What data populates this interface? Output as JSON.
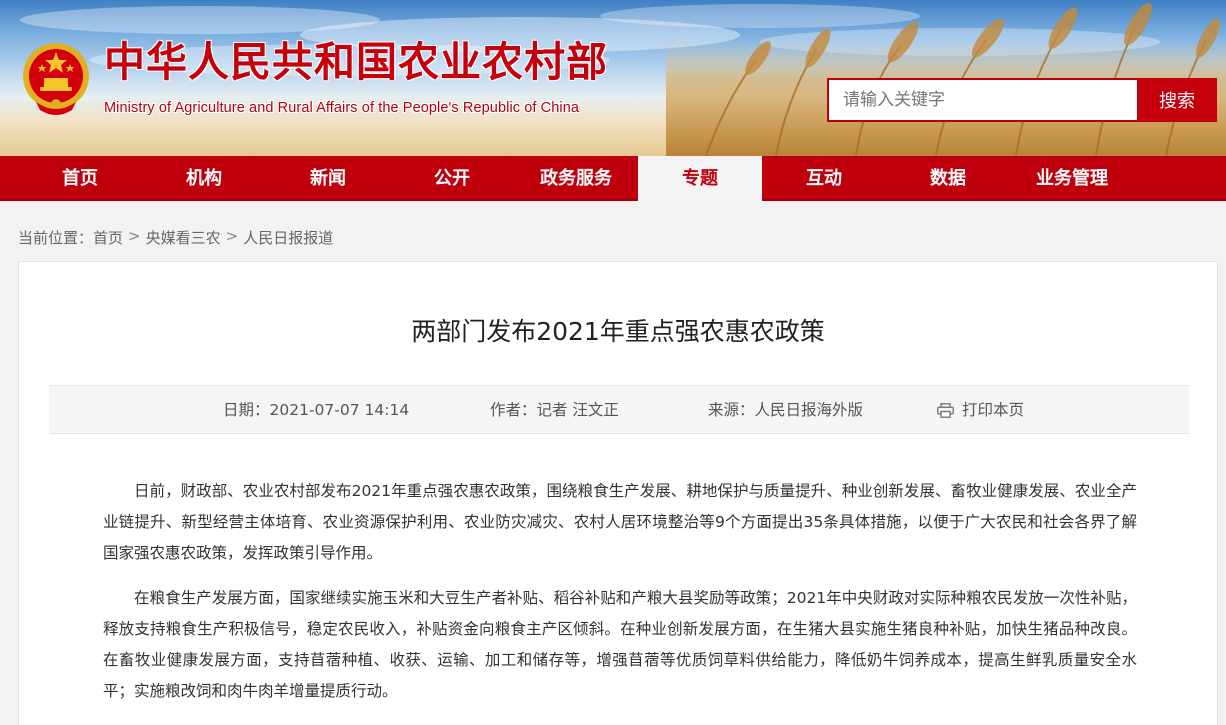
{
  "header": {
    "title": "中华人民共和国农业农村部",
    "subtitle": "Ministry of Agriculture and Rural Affairs of the People's Republic of China",
    "emblem_icon": "national-emblem-icon",
    "search_placeholder": "请输入关键字",
    "search_button": "搜索"
  },
  "nav": {
    "items": [
      {
        "label": "首页"
      },
      {
        "label": "机构"
      },
      {
        "label": "新闻"
      },
      {
        "label": "公开"
      },
      {
        "label": "政务服务"
      },
      {
        "label": "专题"
      },
      {
        "label": "互动"
      },
      {
        "label": "数据"
      },
      {
        "label": "业务管理"
      }
    ],
    "active": "专题"
  },
  "breadcrumb": {
    "prefix": "当前位置：",
    "items": [
      "首页",
      "央媒看三农",
      "人民日报报道"
    ],
    "separator": ">"
  },
  "article": {
    "title": "两部门发布2021年重点强农惠农政策",
    "meta": {
      "date": "日期：2021-07-07 14:14",
      "author": "作者：记者 汪文正",
      "source": "来源：人民日报海外版",
      "print": "打印本页",
      "print_icon": "printer-icon"
    },
    "paragraphs": [
      "日前，财政部、农业农村部发布2021年重点强农惠农政策，围绕粮食生产发展、耕地保护与质量提升、种业创新发展、畜牧业健康发展、农业全产业链提升、新型经营主体培育、农业资源保护利用、农业防灾减灾、农村人居环境整治等9个方面提出35条具体措施，以便于广大农民和社会各界了解国家强农惠农政策，发挥政策引导作用。",
      "在粮食生产发展方面，国家继续实施玉米和大豆生产者补贴、稻谷补贴和产粮大县奖励等政策；2021年中央财政对实际种粮农民发放一次性补贴，释放支持粮食生产积极信号，稳定农民收入，补贴资金向粮食主产区倾斜。在种业创新发展方面，在生猪大县实施生猪良种补贴，加快生猪品种改良。在畜牧业健康发展方面，支持苜蓿种植、收获、运输、加工和储存等，增强苜蓿等优质饲草料供给能力，降低奶牛饲养成本，提高生鲜乳质量安全水平；实施粮改饲和肉牛肉羊增量提质行动。"
    ]
  },
  "colors": {
    "brand_red": "#c5000c",
    "nav_active_bg": "#f4f4f4",
    "meta_bg": "#f5f5f5"
  }
}
